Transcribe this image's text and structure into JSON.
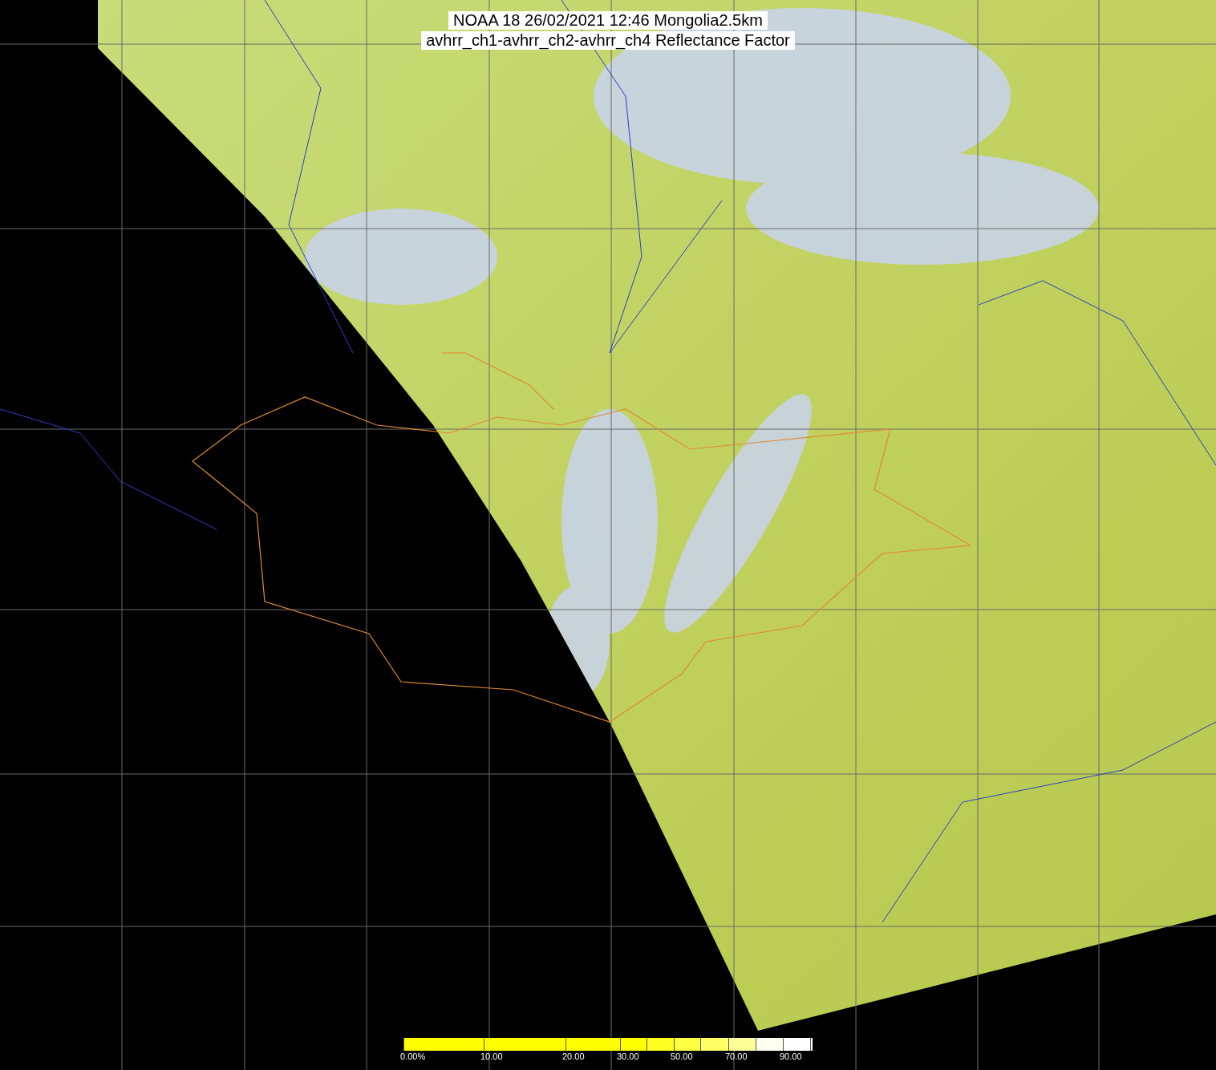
{
  "title": {
    "lines": [
      "NOAA 18 26/02/2021 12:46 Mongolia2.5km",
      "avhrr_ch1-avhrr_ch2-avhrr_ch4 Reflectance Factor"
    ]
  },
  "colorbar": {
    "segments": [
      {
        "color": "#ffff00",
        "label": "0.00%"
      },
      {
        "color": "#ffff00",
        "label": "10.00"
      },
      {
        "color": "#ffff00",
        "label": "20.00"
      },
      {
        "color": "#ffff00",
        "label": "30.00"
      },
      {
        "color": "#ffff22"
      },
      {
        "color": "#ffff44",
        "label": "50.00"
      },
      {
        "color": "#ffff66"
      },
      {
        "color": "#ffff99",
        "label": "70.00"
      },
      {
        "color": "#fffff0"
      },
      {
        "color": "#ffffff",
        "label": "90.00"
      },
      {
        "color": "#ffffff"
      }
    ]
  }
}
